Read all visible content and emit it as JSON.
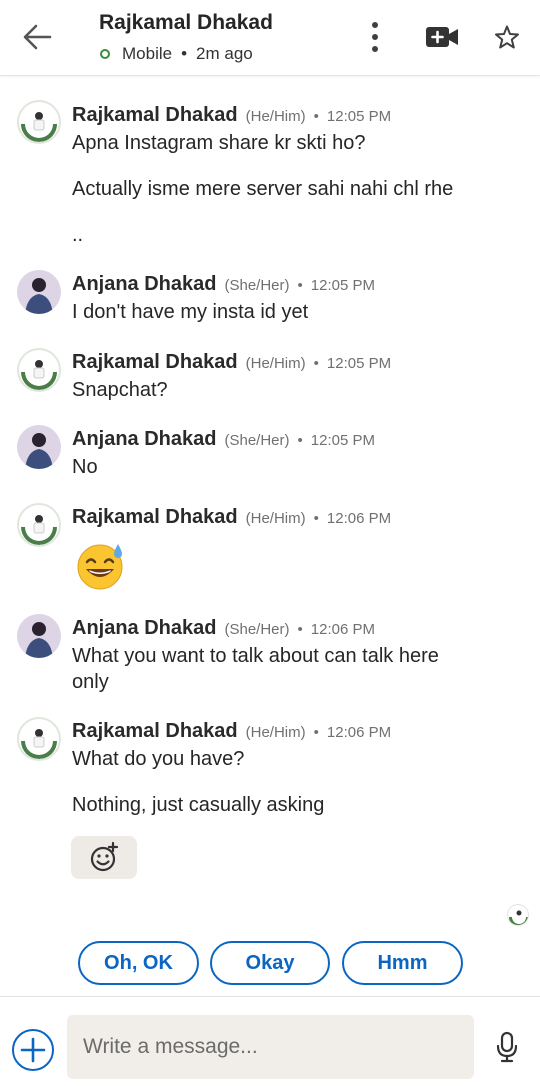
{
  "header": {
    "title": "Rajkamal Dhakad",
    "status": "Mobile",
    "separator": "•",
    "last_seen": "2m ago",
    "icons": [
      "back-arrow-icon",
      "more-vertical-icon",
      "video-plus-icon",
      "star-icon"
    ]
  },
  "messages": [
    {
      "name": "Rajkamal Dhakad",
      "pronouns": "(He/Him)",
      "dot": "•",
      "time": "12:05 PM",
      "lines": [
        "Apna Instagram share kr skti ho?",
        "Actually isme mere server sahi nahi chl rhe",
        ".."
      ]
    },
    {
      "name": "Anjana Dhakad",
      "pronouns": "(She/Her)",
      "dot": "•",
      "time": "12:05 PM",
      "lines": [
        "I don't have my insta id yet"
      ]
    },
    {
      "name": "Rajkamal Dhakad",
      "pronouns": "(He/Him)",
      "dot": "•",
      "time": "12:05 PM",
      "lines": [
        "Snapchat?"
      ]
    },
    {
      "name": "Anjana Dhakad",
      "pronouns": "(She/Her)",
      "dot": "•",
      "time": "12:05 PM",
      "lines": [
        "No"
      ]
    },
    {
      "name": "Rajkamal Dhakad",
      "pronouns": "(He/Him)",
      "dot": "•",
      "time": "12:06 PM",
      "emoji": "grinning-sweat-emoji"
    },
    {
      "name": "Anjana Dhakad",
      "pronouns": "(She/Her)",
      "dot": "•",
      "time": "12:06 PM",
      "lines": [
        "What you want to talk about can talk here",
        "only"
      ]
    },
    {
      "name": "Rajkamal Dhakad",
      "pronouns": "(He/Him)",
      "dot": "•",
      "time": "12:06 PM",
      "lines": [
        "What do you have?",
        "Nothing, just casually asking"
      ]
    }
  ],
  "reaction": {
    "icon": "add-reaction-icon"
  },
  "suggestions": [
    "Oh, OK",
    "Okay",
    "Hmm"
  ],
  "compose": {
    "placeholder": "Write a message...",
    "icons": [
      "plus-icon",
      "microphone-icon"
    ]
  },
  "colors": {
    "accent": "#0a66c2",
    "online": "#3a8c3a",
    "input_bg": "#f1eee9"
  }
}
